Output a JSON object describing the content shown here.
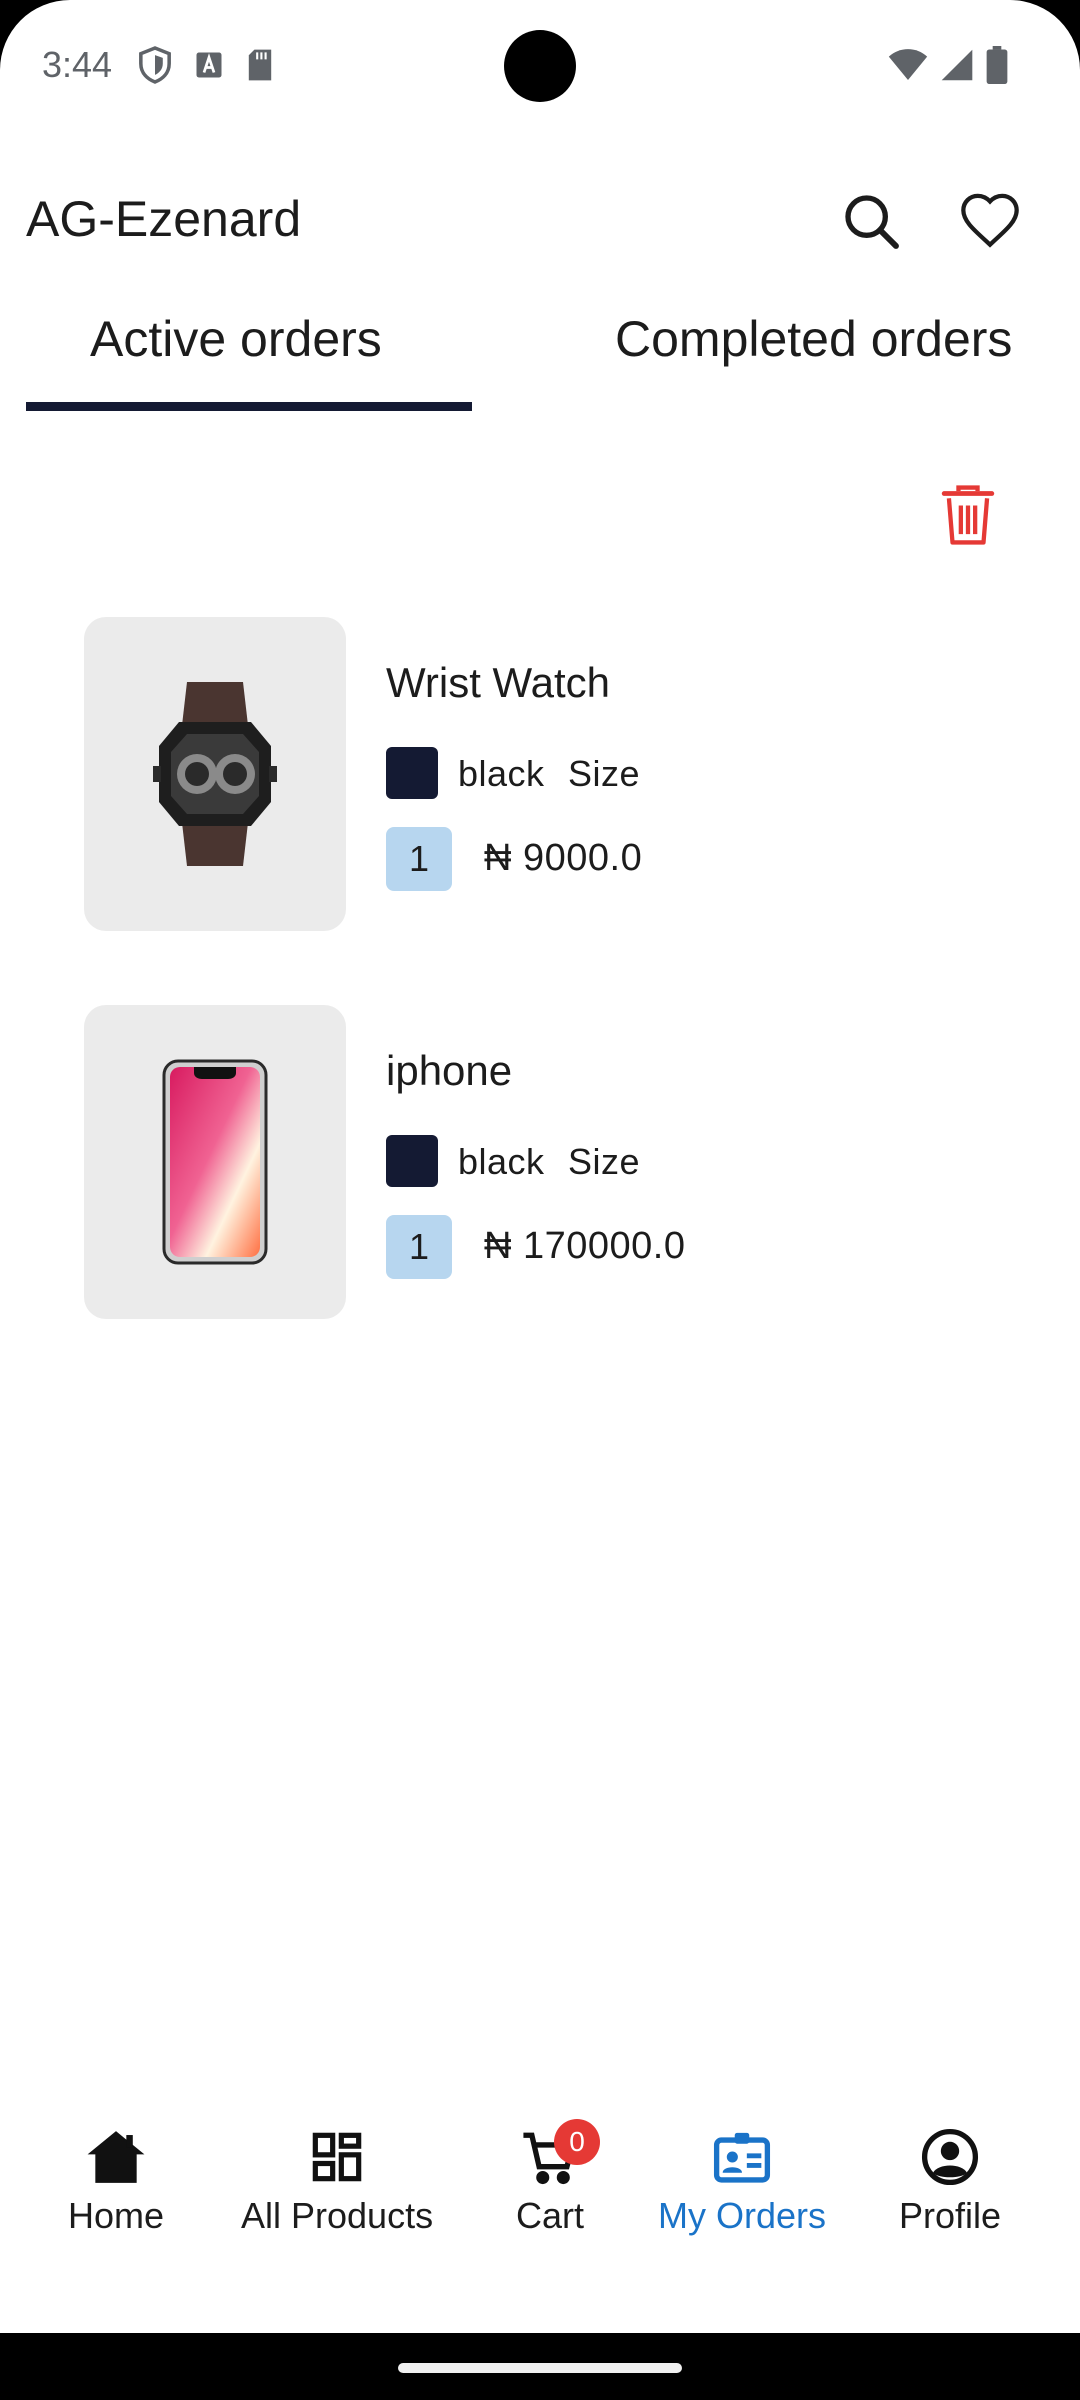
{
  "status_bar": {
    "time": "3:44"
  },
  "app_bar": {
    "title": "AG-Ezenard"
  },
  "tabs": [
    {
      "label": "Active orders",
      "active": true
    },
    {
      "label": "Completed orders",
      "active": false
    }
  ],
  "orders": [
    {
      "name": "Wrist Watch",
      "color": "black",
      "size_label": "Size",
      "quantity": "1",
      "price": "₦ 9000.0",
      "swatch_color": "#141a33",
      "image": "wrist-watch"
    },
    {
      "name": "iphone",
      "color": "black",
      "size_label": "Size",
      "quantity": "1",
      "price": "₦ 170000.0",
      "swatch_color": "#141a33",
      "image": "iphone"
    }
  ],
  "bottom_nav": {
    "items": [
      {
        "label": "Home",
        "icon": "home-icon"
      },
      {
        "label": "All Products",
        "icon": "grid-icon"
      },
      {
        "label": "Cart",
        "icon": "cart-icon",
        "badge": "0"
      },
      {
        "label": "My Orders",
        "icon": "orders-icon",
        "active": true
      },
      {
        "label": "Profile",
        "icon": "profile-icon"
      }
    ]
  },
  "colors": {
    "accent": "#1a73c8",
    "indicator": "#141a33",
    "delete": "#e53935",
    "qty_bg": "#b7d6ef"
  }
}
